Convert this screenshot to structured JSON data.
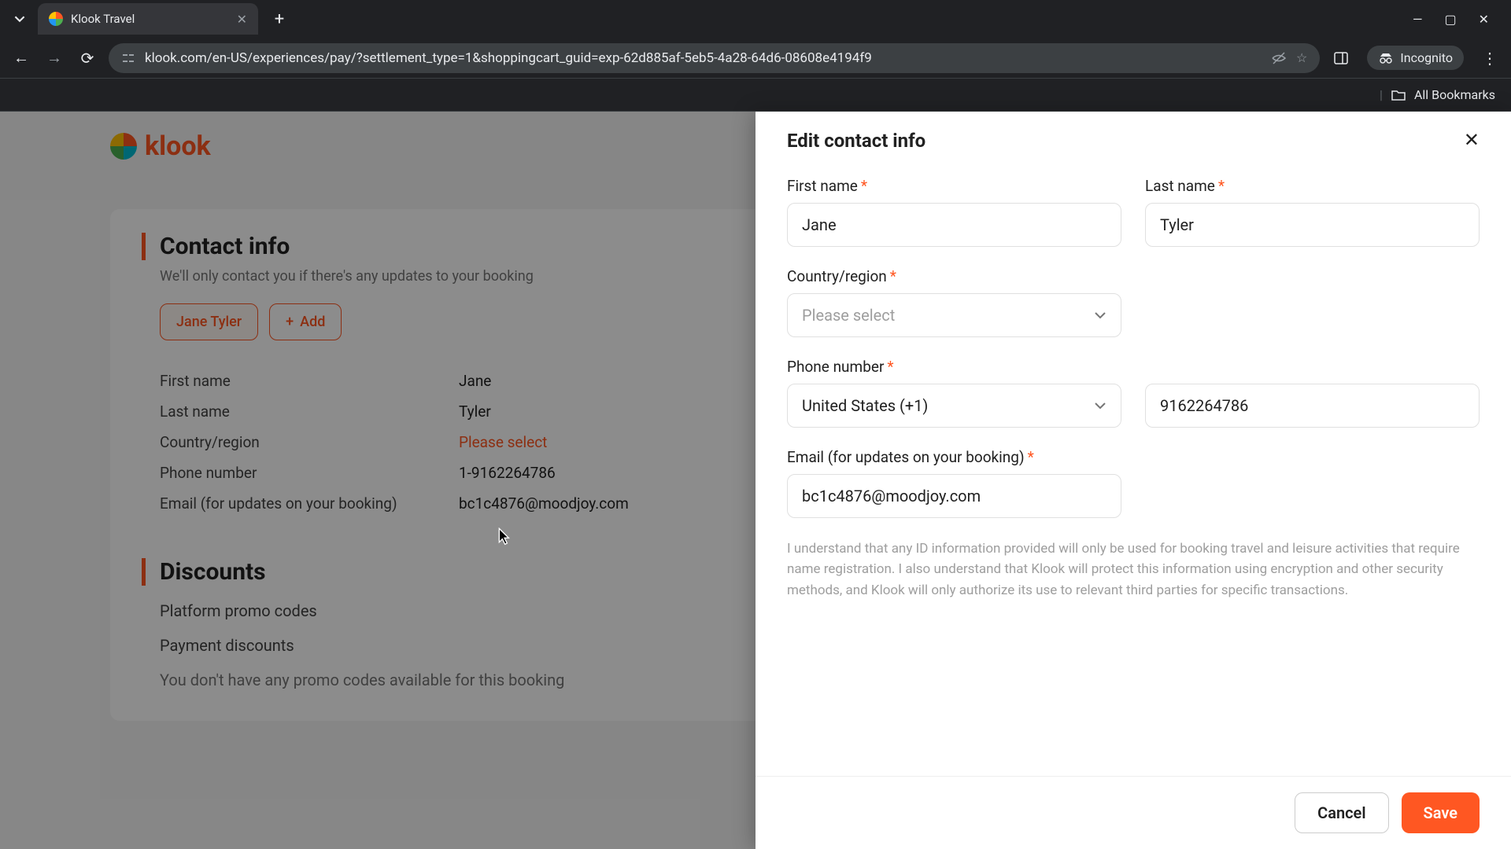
{
  "browser": {
    "tab_title": "Klook Travel",
    "url": "klook.com/en-US/experiences/pay/?settlement_type=1&shoppingcart_guid=exp-62d885af-5eb5-4a28-64d6-08608e4194f9",
    "incognito_label": "Incognito",
    "all_bookmarks": "All Bookmarks"
  },
  "logo_text": "klook",
  "contact_section": {
    "title": "Contact info",
    "subtitle": "We'll only contact you if there's any updates to your booking",
    "chip_name": "Jane Tyler",
    "chip_add": "Add",
    "rows": {
      "first_name_label": "First name",
      "first_name_value": "Jane",
      "last_name_label": "Last name",
      "last_name_value": "Tyler",
      "country_label": "Country/region",
      "country_value": "Please select",
      "phone_label": "Phone number",
      "phone_value": "1-9162264786",
      "email_label": "Email (for updates on your booking)",
      "email_value": "bc1c4876@moodjoy.com"
    }
  },
  "discounts_section": {
    "title": "Discounts",
    "line1": "Platform promo codes",
    "line2": "Payment discounts",
    "empty": "You don't have any promo codes available for this booking"
  },
  "panel": {
    "title": "Edit contact info",
    "first_name_label": "First name",
    "first_name_value": "Jane",
    "last_name_label": "Last name",
    "last_name_value": "Tyler",
    "country_label": "Country/region",
    "country_placeholder": "Please select",
    "phone_label": "Phone number",
    "phone_country_value": "United States (+1)",
    "phone_number_value": "9162264786",
    "email_label": "Email (for updates on your booking)",
    "email_value": "bc1c4876@moodjoy.com",
    "disclaimer": "I understand that any ID information provided will only be used for booking travel and leisure activities that require name registration. I also understand that Klook will protect this information using encryption and other security methods, and Klook will only authorize its use to relevant third parties for specific transactions.",
    "cancel": "Cancel",
    "save": "Save"
  }
}
